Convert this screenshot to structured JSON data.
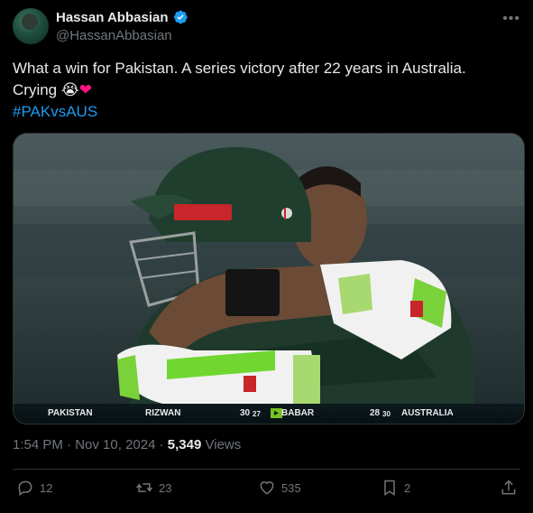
{
  "author": {
    "name": "Hassan Abbasian",
    "handle": "@HassanAbbasian"
  },
  "tweet": {
    "line1": "What a win for Pakistan. A series victory after 22 years in Australia.",
    "line2": "Crying ",
    "emoji_cry": "😭",
    "emoji_heart": "❤",
    "hashtag": "#PAKvsAUS"
  },
  "media": {
    "scoreboard": {
      "team_left": "PAKISTAN",
      "batter1": "RIZWAN",
      "batter1_score": "30",
      "batter1_balls": "27",
      "batter2": "BABAR",
      "batter2_score": "28",
      "batter2_balls": "30",
      "team_right": "AUSTRALIA"
    }
  },
  "meta": {
    "time": "1:54 PM",
    "sep1": " · ",
    "date": "Nov 10, 2024",
    "sep2": " · ",
    "views_count": "5,349",
    "views_label": " Views"
  },
  "actions": {
    "replies": "12",
    "reposts": "23",
    "likes": "535",
    "bookmarks": "2"
  },
  "colors": {
    "accent": "#1d9bf0",
    "heart": "#f91880",
    "muted": "#71767b"
  }
}
